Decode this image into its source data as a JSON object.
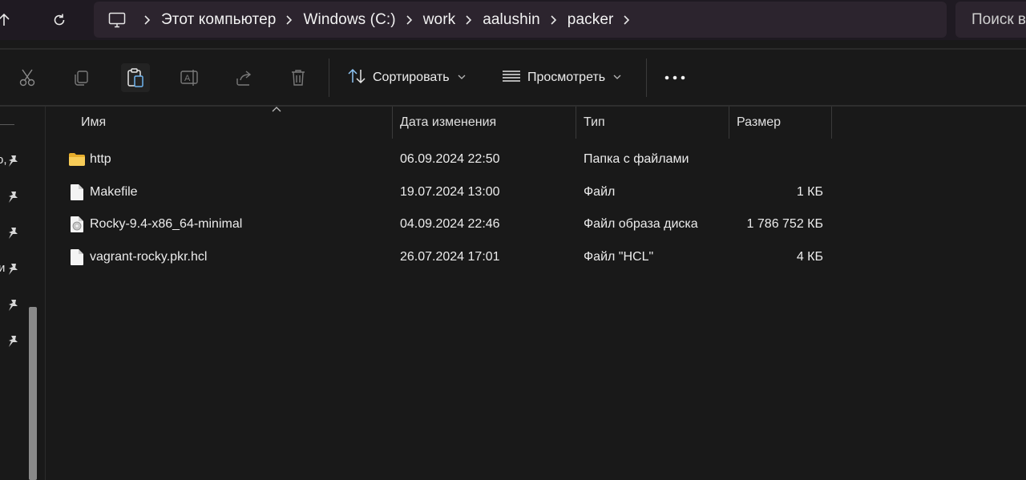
{
  "address_bar": {
    "breadcrumbs": [
      "Этот компьютер",
      "Windows (C:)",
      "work",
      "aalushin",
      "packer"
    ],
    "search_placeholder": "Поиск в"
  },
  "toolbar": {
    "tools": [
      "cut-icon",
      "copy-icon",
      "paste-icon",
      "rename-icon",
      "share-icon",
      "delete-icon"
    ],
    "sort_label": "Сортировать",
    "view_label": "Просмотреть",
    "more_icon": "ellipsis-icon"
  },
  "nav_pane": {
    "pinned_items": [
      {
        "truncated_text": "о,"
      },
      {
        "truncated_text": ""
      },
      {
        "truncated_text": ""
      },
      {
        "truncated_text": "и"
      },
      {
        "truncated_text": ""
      },
      {
        "truncated_text": ""
      }
    ]
  },
  "file_list": {
    "columns": {
      "name": "Имя",
      "date": "Дата изменения",
      "type": "Тип",
      "size": "Размер"
    },
    "sort_column": "name",
    "rows": [
      {
        "icon": "folder-icon",
        "name": "http",
        "date": "06.09.2024 22:50",
        "type": "Папка с файлами",
        "size": ""
      },
      {
        "icon": "file-icon",
        "name": "Makefile",
        "date": "19.07.2024 13:00",
        "type": "Файл",
        "size": "1 КБ"
      },
      {
        "icon": "disk-image-icon",
        "name": "Rocky-9.4-x86_64-minimal",
        "date": "04.09.2024 22:46",
        "type": "Файл образа диска",
        "size": "1 786 752 КБ"
      },
      {
        "icon": "file-icon",
        "name": "vagrant-rocky.pkr.hcl",
        "date": "26.07.2024 17:01",
        "type": "Файл \"HCL\"",
        "size": "4 КБ"
      }
    ]
  },
  "colors": {
    "background": "#191919",
    "address_bar_bg": "#1f1a22",
    "breadcrumb_bg": "#2c242e",
    "folder": "#f4c74f"
  }
}
